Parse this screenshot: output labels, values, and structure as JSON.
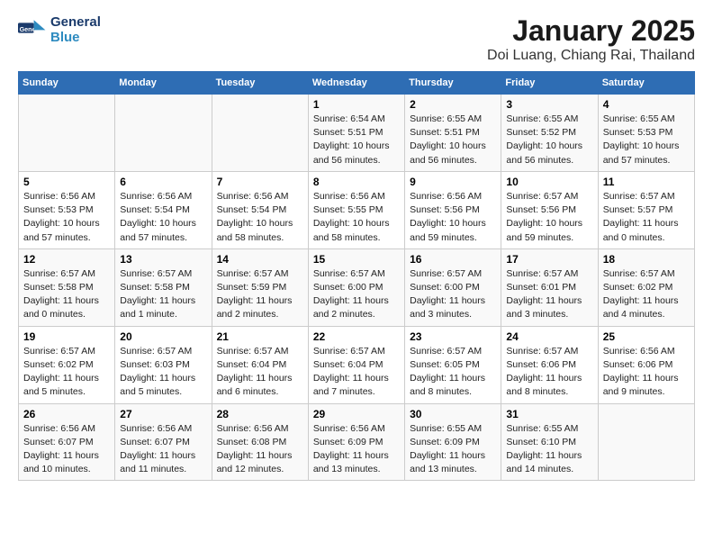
{
  "header": {
    "logo_line1": "General",
    "logo_line2": "Blue",
    "main_title": "January 2025",
    "subtitle": "Doi Luang, Chiang Rai, Thailand"
  },
  "days_of_week": [
    "Sunday",
    "Monday",
    "Tuesday",
    "Wednesday",
    "Thursday",
    "Friday",
    "Saturday"
  ],
  "weeks": [
    [
      {
        "day": "",
        "info": ""
      },
      {
        "day": "",
        "info": ""
      },
      {
        "day": "",
        "info": ""
      },
      {
        "day": "1",
        "info": "Sunrise: 6:54 AM\nSunset: 5:51 PM\nDaylight: 10 hours and 56 minutes."
      },
      {
        "day": "2",
        "info": "Sunrise: 6:55 AM\nSunset: 5:51 PM\nDaylight: 10 hours and 56 minutes."
      },
      {
        "day": "3",
        "info": "Sunrise: 6:55 AM\nSunset: 5:52 PM\nDaylight: 10 hours and 56 minutes."
      },
      {
        "day": "4",
        "info": "Sunrise: 6:55 AM\nSunset: 5:53 PM\nDaylight: 10 hours and 57 minutes."
      }
    ],
    [
      {
        "day": "5",
        "info": "Sunrise: 6:56 AM\nSunset: 5:53 PM\nDaylight: 10 hours and 57 minutes."
      },
      {
        "day": "6",
        "info": "Sunrise: 6:56 AM\nSunset: 5:54 PM\nDaylight: 10 hours and 57 minutes."
      },
      {
        "day": "7",
        "info": "Sunrise: 6:56 AM\nSunset: 5:54 PM\nDaylight: 10 hours and 58 minutes."
      },
      {
        "day": "8",
        "info": "Sunrise: 6:56 AM\nSunset: 5:55 PM\nDaylight: 10 hours and 58 minutes."
      },
      {
        "day": "9",
        "info": "Sunrise: 6:56 AM\nSunset: 5:56 PM\nDaylight: 10 hours and 59 minutes."
      },
      {
        "day": "10",
        "info": "Sunrise: 6:57 AM\nSunset: 5:56 PM\nDaylight: 10 hours and 59 minutes."
      },
      {
        "day": "11",
        "info": "Sunrise: 6:57 AM\nSunset: 5:57 PM\nDaylight: 11 hours and 0 minutes."
      }
    ],
    [
      {
        "day": "12",
        "info": "Sunrise: 6:57 AM\nSunset: 5:58 PM\nDaylight: 11 hours and 0 minutes."
      },
      {
        "day": "13",
        "info": "Sunrise: 6:57 AM\nSunset: 5:58 PM\nDaylight: 11 hours and 1 minute."
      },
      {
        "day": "14",
        "info": "Sunrise: 6:57 AM\nSunset: 5:59 PM\nDaylight: 11 hours and 2 minutes."
      },
      {
        "day": "15",
        "info": "Sunrise: 6:57 AM\nSunset: 6:00 PM\nDaylight: 11 hours and 2 minutes."
      },
      {
        "day": "16",
        "info": "Sunrise: 6:57 AM\nSunset: 6:00 PM\nDaylight: 11 hours and 3 minutes."
      },
      {
        "day": "17",
        "info": "Sunrise: 6:57 AM\nSunset: 6:01 PM\nDaylight: 11 hours and 3 minutes."
      },
      {
        "day": "18",
        "info": "Sunrise: 6:57 AM\nSunset: 6:02 PM\nDaylight: 11 hours and 4 minutes."
      }
    ],
    [
      {
        "day": "19",
        "info": "Sunrise: 6:57 AM\nSunset: 6:02 PM\nDaylight: 11 hours and 5 minutes."
      },
      {
        "day": "20",
        "info": "Sunrise: 6:57 AM\nSunset: 6:03 PM\nDaylight: 11 hours and 5 minutes."
      },
      {
        "day": "21",
        "info": "Sunrise: 6:57 AM\nSunset: 6:04 PM\nDaylight: 11 hours and 6 minutes."
      },
      {
        "day": "22",
        "info": "Sunrise: 6:57 AM\nSunset: 6:04 PM\nDaylight: 11 hours and 7 minutes."
      },
      {
        "day": "23",
        "info": "Sunrise: 6:57 AM\nSunset: 6:05 PM\nDaylight: 11 hours and 8 minutes."
      },
      {
        "day": "24",
        "info": "Sunrise: 6:57 AM\nSunset: 6:06 PM\nDaylight: 11 hours and 8 minutes."
      },
      {
        "day": "25",
        "info": "Sunrise: 6:56 AM\nSunset: 6:06 PM\nDaylight: 11 hours and 9 minutes."
      }
    ],
    [
      {
        "day": "26",
        "info": "Sunrise: 6:56 AM\nSunset: 6:07 PM\nDaylight: 11 hours and 10 minutes."
      },
      {
        "day": "27",
        "info": "Sunrise: 6:56 AM\nSunset: 6:07 PM\nDaylight: 11 hours and 11 minutes."
      },
      {
        "day": "28",
        "info": "Sunrise: 6:56 AM\nSunset: 6:08 PM\nDaylight: 11 hours and 12 minutes."
      },
      {
        "day": "29",
        "info": "Sunrise: 6:56 AM\nSunset: 6:09 PM\nDaylight: 11 hours and 13 minutes."
      },
      {
        "day": "30",
        "info": "Sunrise: 6:55 AM\nSunset: 6:09 PM\nDaylight: 11 hours and 13 minutes."
      },
      {
        "day": "31",
        "info": "Sunrise: 6:55 AM\nSunset: 6:10 PM\nDaylight: 11 hours and 14 minutes."
      },
      {
        "day": "",
        "info": ""
      }
    ]
  ]
}
